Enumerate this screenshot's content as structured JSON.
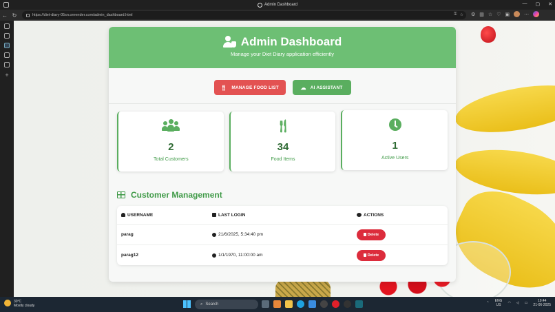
{
  "window": {
    "title": "Admin Dashboard"
  },
  "browser": {
    "url": "https://diet-diary-05sn.onrender.com/admin_dashboard.html"
  },
  "header": {
    "title": "Admin Dashboard",
    "subtitle": "Manage your Diet Diary application efficiently"
  },
  "actions": {
    "manage_food": "MANAGE FOOD LIST",
    "ai_assistant": "AI ASSISTANT"
  },
  "stats": [
    {
      "value": "2",
      "label": "Total Customers",
      "icon": "users-icon"
    },
    {
      "value": "34",
      "label": "Food Items",
      "icon": "utensils-icon"
    },
    {
      "value": "1",
      "label": "Active Users",
      "icon": "clock-icon"
    }
  ],
  "customers": {
    "title": "Customer Management",
    "columns": {
      "username": "USERNAME",
      "last_login": "LAST LOGIN",
      "actions": "ACTIONS"
    },
    "rows": [
      {
        "username": "parag",
        "last_login": "21/6/2025, 5:34:40 pm",
        "action": "Delete"
      },
      {
        "username": "parag12",
        "last_login": "1/1/1970, 11:00:00 am",
        "action": "Delete"
      }
    ]
  },
  "taskbar": {
    "weather_temp": "30°C",
    "weather_desc": "Mostly cloudy",
    "search": "Search",
    "lang_top": "ENG",
    "lang_bottom": "US",
    "time": "19:44",
    "date": "21-06-2025"
  },
  "colors": {
    "accent": "#6dbf74",
    "danger": "#dc2c3c",
    "primary_text": "#3f9a47"
  }
}
